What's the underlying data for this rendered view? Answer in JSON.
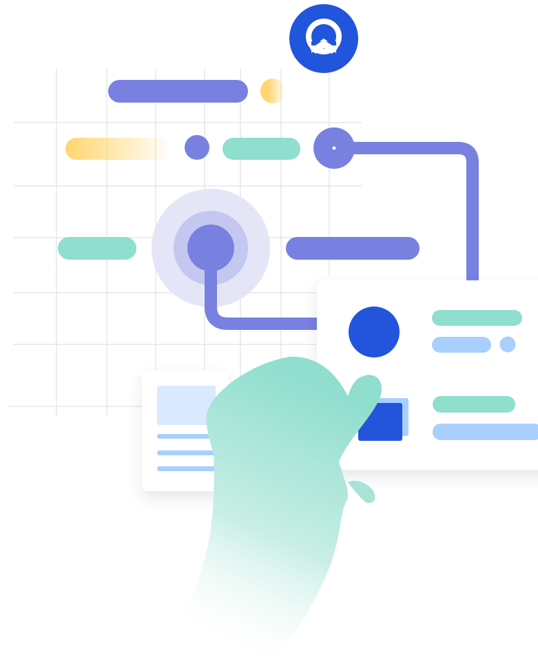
{
  "illustration": {
    "logo": {
      "icon": "upward-chevron-ring-icon"
    },
    "palette": {
      "indigo": "#7880e0",
      "royal_blue": "#2155dc",
      "mint": "#8fdece",
      "yellow": "#ffd66e",
      "pale_blue": "#a9cfff",
      "grid": "#d8d8d8",
      "card": "#ffffff"
    },
    "hand": {
      "icon": "pointing-hand-icon"
    },
    "glow": {
      "icon": "radar-pulse-icon"
    }
  }
}
